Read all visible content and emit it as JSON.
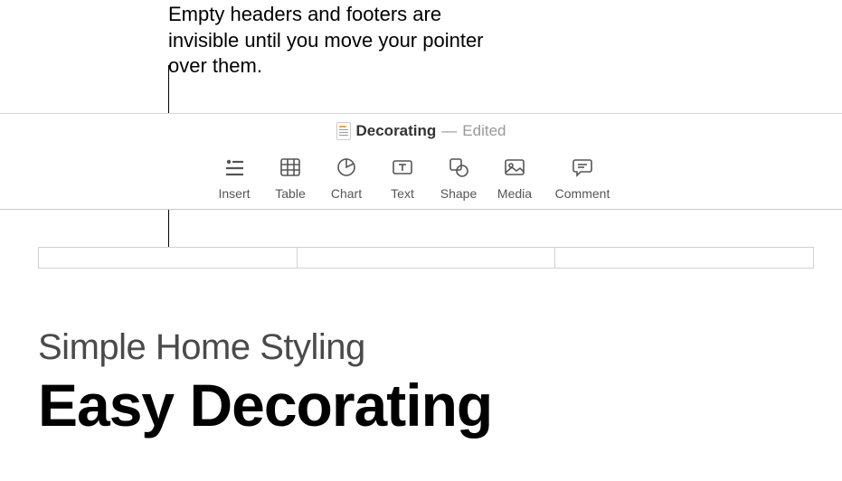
{
  "callout": {
    "text": "Empty headers and footers are invisible until you move your pointer over them."
  },
  "titlebar": {
    "doc_name": "Decorating",
    "dash": "—",
    "status": "Edited"
  },
  "toolbar": {
    "insert": "Insert",
    "table": "Table",
    "chart": "Chart",
    "text": "Text",
    "shape": "Shape",
    "media": "Media",
    "comment": "Comment"
  },
  "document": {
    "subtitle": "Simple Home Styling",
    "title": "Easy Decorating"
  }
}
